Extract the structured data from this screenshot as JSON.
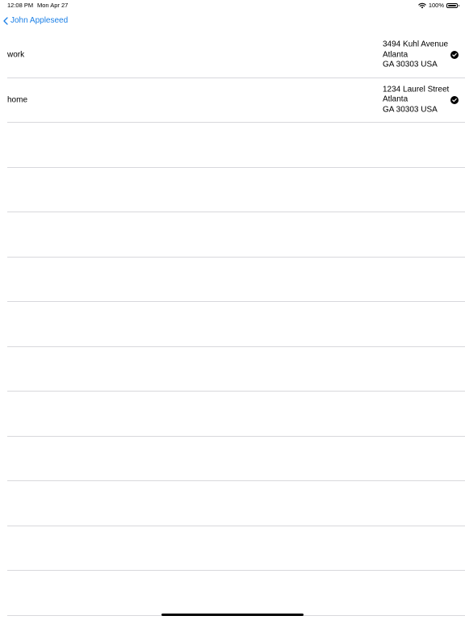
{
  "status_bar": {
    "time": "12:08 PM",
    "date": "Mon Apr 27",
    "battery": "100%"
  },
  "nav": {
    "back_label": "John  Appleseed"
  },
  "addresses": [
    {
      "label": "work",
      "lines": [
        "3494 Kuhl Avenue",
        "Atlanta",
        "GA 30303 USA"
      ],
      "selected": true
    },
    {
      "label": "home",
      "lines": [
        "1234 Laurel Street",
        "Atlanta",
        "GA 30303 USA"
      ],
      "selected": true
    }
  ],
  "empty_rows": 11,
  "colors": {
    "accent": "#1a7fe6",
    "separator": "#d8d8dc"
  }
}
